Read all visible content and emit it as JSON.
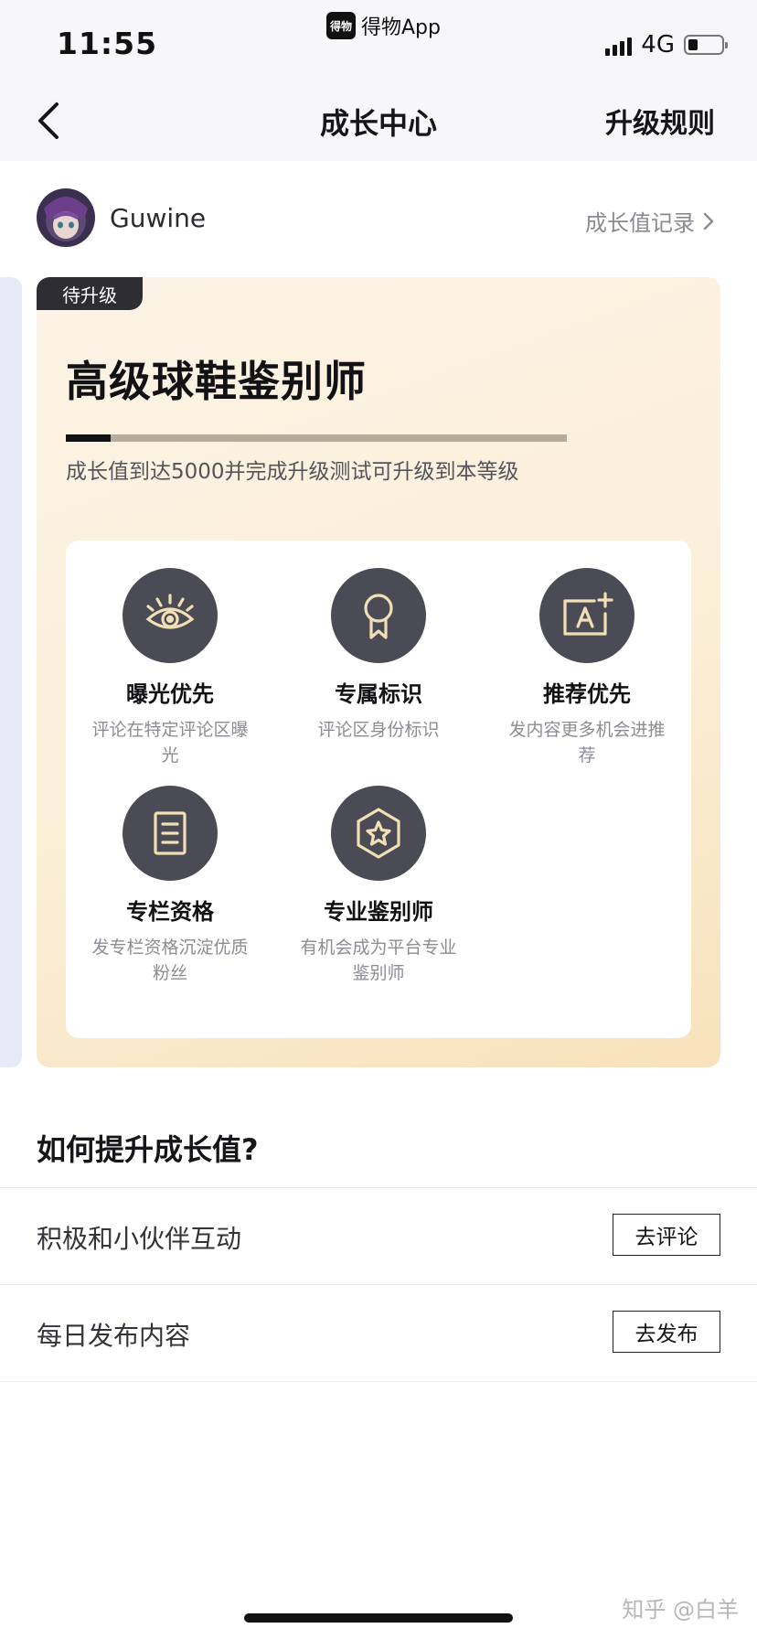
{
  "status_bar": {
    "time": "11:55",
    "app_logo_text": "得物",
    "app_name": "得物App",
    "network": "4G",
    "battery_level": 0.3
  },
  "nav": {
    "back_icon": "chevron-left-icon",
    "title": "成长中心",
    "right_action": "升级规则"
  },
  "user": {
    "name": "Guwine",
    "growth_record_label": "成长值记录"
  },
  "level_card": {
    "tag": "待升级",
    "title": "高级球鞋鉴别师",
    "progress": 0.09,
    "description": "成长值到达5000并完成升级测试可升级到本等级",
    "benefits": [
      {
        "icon": "eye-icon",
        "title": "曝光优先",
        "desc": "评论在特定评论区曝光"
      },
      {
        "icon": "ribbon-badge-icon",
        "title": "专属标识",
        "desc": "评论区身份标识"
      },
      {
        "icon": "recommend-icon",
        "title": "推荐优先",
        "desc": "发内容更多机会进推荐"
      },
      {
        "icon": "column-document-icon",
        "title": "专栏资格",
        "desc": "发专栏资格沉淀优质粉丝"
      },
      {
        "icon": "star-hexagon-icon",
        "title": "专业鉴别师",
        "desc": "有机会成为平台专业鉴别师"
      }
    ]
  },
  "how_section": {
    "title": "如何提升成长值?",
    "tasks": [
      {
        "label": "积极和小伙伴互动",
        "button": "去评论"
      },
      {
        "label": "每日发布内容",
        "button": "去发布"
      }
    ]
  },
  "watermark": "知乎 @白羊",
  "colors": {
    "card_gradient_start": "#fbf3e6",
    "card_gradient_end": "#f7e2bb",
    "icon_circle": "#4b4b55",
    "icon_stroke": "#f1dfb6",
    "tag_bg": "#2d2d32"
  }
}
